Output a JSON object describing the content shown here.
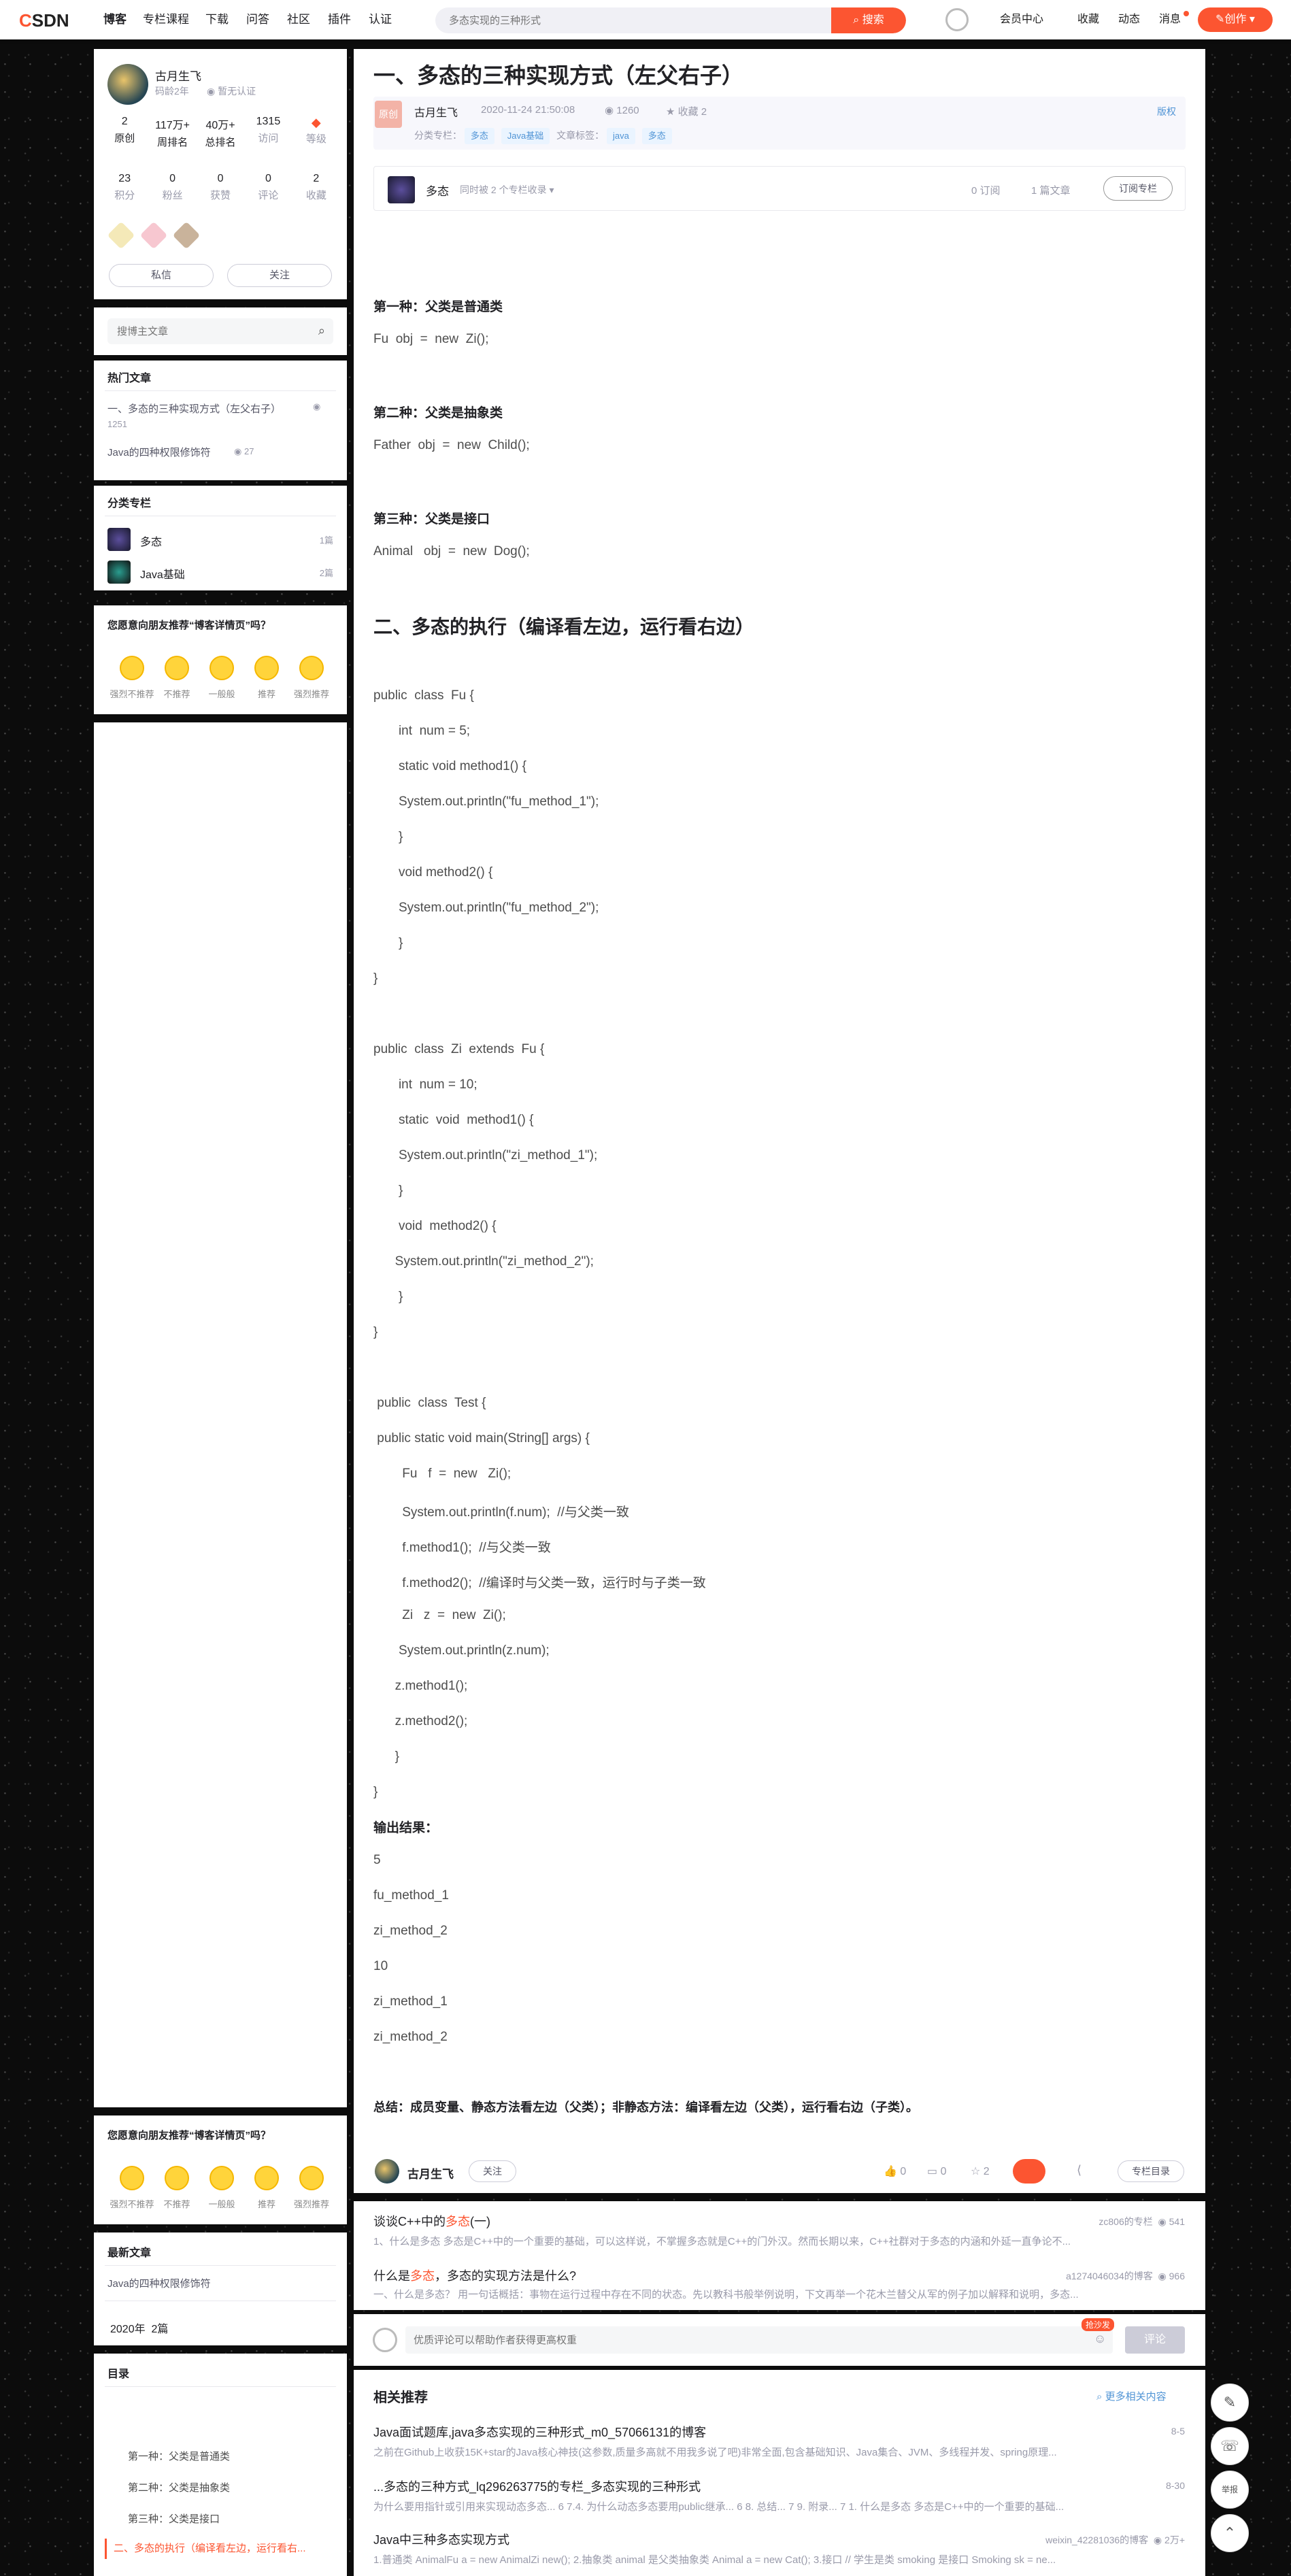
{
  "topnav": {
    "logo_mark": "C",
    "logo_text": "SDN",
    "items": [
      "博客",
      "专栏课程",
      "下载",
      "问答",
      "社区",
      "插件",
      "认证"
    ],
    "search_placeholder": "多态实现的三种形式",
    "search_button": "搜索",
    "right_items": [
      "会员中心",
      "收藏",
      "动态",
      "消息"
    ],
    "create_button": "创作"
  },
  "profile": {
    "name": "古月生飞",
    "years": "码龄2年",
    "verify": "暂无认证",
    "stats1": [
      {
        "value": "2",
        "label": "原创"
      },
      {
        "value": "117万+",
        "label": "周排名"
      },
      {
        "value": "40万+",
        "label": "总排名"
      },
      {
        "value": "1315",
        "label": "访问"
      },
      {
        "value": "",
        "label": "等级"
      }
    ],
    "stats2": [
      {
        "value": "23",
        "label": "积分"
      },
      {
        "value": "0",
        "label": "粉丝"
      },
      {
        "value": "0",
        "label": "获赞"
      },
      {
        "value": "0",
        "label": "评论"
      },
      {
        "value": "2",
        "label": "收藏"
      }
    ],
    "msg_button": "私信",
    "follow_button": "关注"
  },
  "search_blog": {
    "placeholder": "搜博主文章"
  },
  "hot": {
    "title": "热门文章",
    "items": [
      {
        "title": "一、多态的三种实现方式（左父右子）",
        "views": "1251"
      },
      {
        "title": "Java的四种权限修饰符",
        "views": "27"
      }
    ]
  },
  "columns": {
    "title": "分类专栏",
    "items": [
      {
        "name": "多态",
        "count": "1篇"
      },
      {
        "name": "Java基础",
        "count": "2篇"
      }
    ]
  },
  "recommend": {
    "title": "您愿意向朋友推荐“博客详情页”吗？",
    "options": [
      "强烈不推荐",
      "不推荐",
      "一般般",
      "推荐",
      "强烈推荐"
    ]
  },
  "latest": {
    "title": "最新文章",
    "items": [
      "Java的四种权限修饰符"
    ],
    "archive": "2020年",
    "archive_count": "2篇"
  },
  "toc": {
    "title": "目录",
    "items": [
      "第一种：父类是普通类",
      "第二种：父类是抽象类",
      "第三种：父类是接口",
      "二、多态的执行（编译看左边，运行看右..."
    ]
  },
  "article": {
    "title": "一、多态的三种实现方式（左父右子）",
    "original_badge": "原创",
    "author": "古月生飞",
    "date": "2020-11-24 21:50:08",
    "views": "1260",
    "favorites": "收藏 2",
    "copyright": "版权",
    "category_label": "分类专栏：",
    "categories": [
      "多态",
      "Java基础"
    ],
    "tags_label": "文章标签：",
    "tags": [
      "java",
      "多态"
    ],
    "column_name": "多态",
    "column_note": "同时被 2 个专栏收录",
    "column_subs": "0 订阅",
    "column_posts": "1 篇文章",
    "column_sub_button": "订阅专栏",
    "h_first": "第一种：父类是普通类",
    "code_first": "Fu  obj  =  new  Zi();",
    "h_second": "第二种：父类是抽象类",
    "code_second": "Father  obj  =  new  Child();",
    "h_third": "第三种：父类是接口",
    "code_third": "Animal   obj  =  new  Dog();",
    "h2": "二、多态的执行（编译看左边，运行看右边）",
    "code_lines": [
      "public  class  Fu {",
      "       int  num = 5;",
      "       static void method1() {",
      "       System.out.println(\"fu_method_1\");",
      "       }",
      "       void method2() {",
      "       System.out.println(\"fu_method_2\");",
      "       }",
      "}",
      "public  class  Zi  extends  Fu {",
      "       int  num = 10;",
      "       static  void  method1() {",
      "       System.out.println(\"zi_method_1\");",
      "       }",
      "       void  method2() {",
      "      System.out.println(\"zi_method_2\");",
      "       }",
      "}",
      " public  class  Test {",
      " public static void main(String[] args) {",
      "        Fu   f  =  new   Zi();",
      "        System.out.println(f.num);  //与父类一致",
      "        f.method1();  //与父类一致",
      "        f.method2();  //编译时与父类一致，运行时与子类一致",
      "        Zi   z  =  new  Zi();",
      "       System.out.println(z.num);",
      "      z.method1();",
      "      z.method2();",
      "      }",
      "}"
    ],
    "output_label": "输出结果：",
    "output_lines": [
      "5",
      "fu_method_1",
      "zi_method_2",
      "10",
      "zi_method_1",
      "zi_method_2"
    ],
    "summary": "总结：成员变量、静态方法看左边（父类）；非静态方法：编译看左边（父类），运行看右边（子类）。",
    "footer_author": "古月生飞",
    "footer_follow": "关注",
    "likes": "0",
    "comments": "0",
    "stars": "2",
    "toc_button": "专栏目录"
  },
  "related_top": [
    {
      "title_pre": "谈谈C++中的",
      "title_hl": "多态",
      "title_post": "(一)",
      "meta": "zc806的专栏",
      "views": "541",
      "desc": "1、什么是多态 多态是C++中的一个重要的基础，可以这样说，不掌握多态就是C++的门外汉。然而长期以来，C++社群对于多态的内涵和外延一直争论不..."
    },
    {
      "title_pre": "什么是",
      "title_hl": "多态",
      "title_post": "，多态的实现方法是什么?",
      "meta": "a1274046034的博客",
      "views": "966",
      "desc": "一、什么是多态？ 用一句话概括：事物在运行过程中存在不同的状态。先以教科书般举例说明，下文再举一个花木兰替父从军的例子加以解释和说明，多态..."
    }
  ],
  "comment": {
    "placeholder": "优质评论可以帮助作者获得更高权重",
    "badge": "抢沙发",
    "submit": "评论"
  },
  "related": {
    "title": "相关推荐",
    "more": "更多相关内容",
    "items": [
      {
        "title": "Java面试题库,java多态实现的三种形式_m0_57066131的博客",
        "date": "8-5",
        "desc": "之前在Github上收获15K+star的Java核心神技(这参数,质量多高就不用我多说了吧)非常全面,包含基础知识、Java集合、JVM、多线程并发、spring原理..."
      },
      {
        "title": "...多态的三种方式_lq296263775的专栏_多态实现的三种形式",
        "date": "8-30",
        "desc": "为什么要用指针或引用来实现动态多态... 6 7.4. 为什么动态多态要用public继承... 6 8. 总结... 7 9. 附录... 7 1. 什么是多态 多态是C++中的一个重要的基础..."
      },
      {
        "title": "Java中三种多态实现方式",
        "meta": "weixin_42281036的博客",
        "views": "2万+",
        "desc": "1.普通类 AnimalFu a = new AnimalZi new(); 2.抽象类 animal 是父类抽象类 Animal a = new Cat(); 3.接口 // 学生是类 smoking 是接口 Smoking sk = ne..."
      }
    ]
  },
  "fabs": [
    "write-icon",
    "support-icon",
    "report-icon",
    "top-icon"
  ],
  "fab_labels": {
    "report": "举报"
  }
}
